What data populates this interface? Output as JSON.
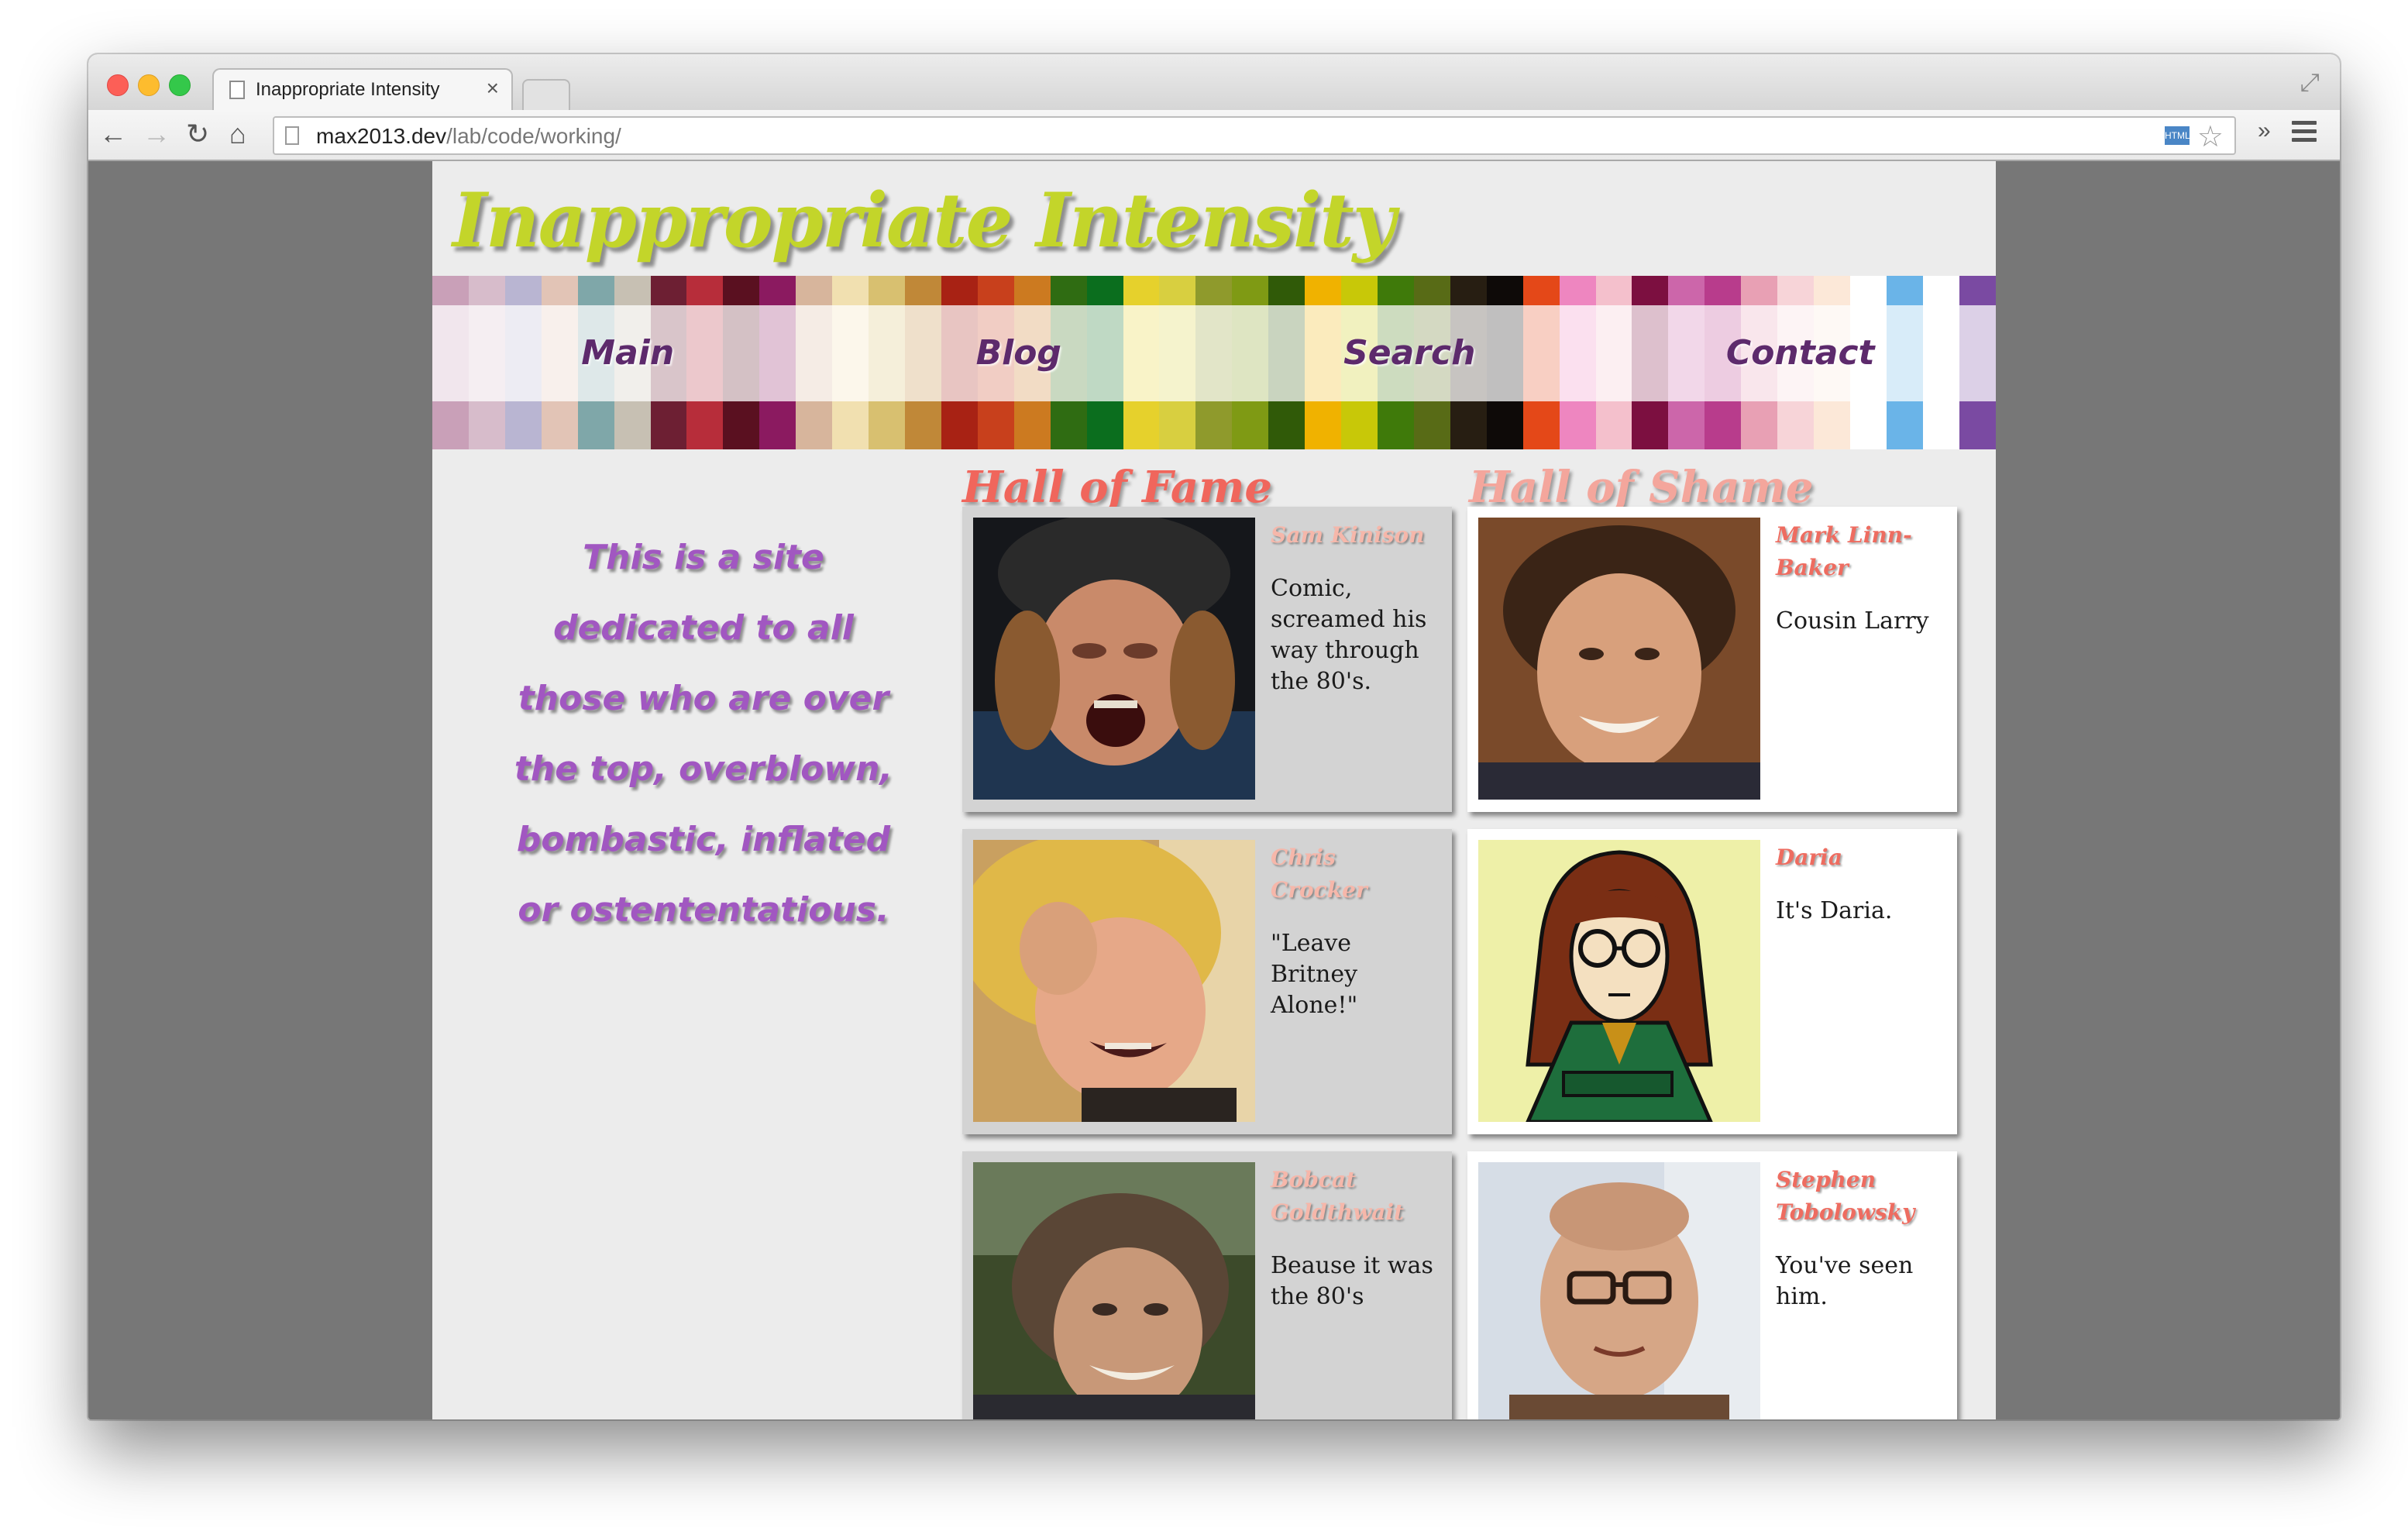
{
  "browser": {
    "tab_title": "Inappropriate Intensity",
    "tab_close": "×",
    "url_host": "max2013.dev",
    "url_path": "/lab/code/working/",
    "icons": {
      "back": "back-arrow-icon",
      "forward": "forward-arrow-icon",
      "reload": "reload-icon",
      "home": "home-icon",
      "star": "star-icon",
      "menu": "hamburger-menu-icon"
    }
  },
  "site": {
    "title": "Inappropriate Intensity",
    "intro": "This is a site dedicated to all those who are over the top, overblown, bombastic, inflated or ostententatious."
  },
  "nav": [
    {
      "label": "Main"
    },
    {
      "label": "Blog"
    },
    {
      "label": "Search"
    },
    {
      "label": "Contact"
    }
  ],
  "hall_of_fame": {
    "heading": "Hall of Fame",
    "cards": [
      {
        "name": "Sam Kinison",
        "description": "Comic, screamed his way through the 80's."
      },
      {
        "name": "Chris Crocker",
        "description": "\"Leave Britney Alone!\""
      },
      {
        "name": "Bobcat Goldthwait",
        "description": "Beause it was the 80's"
      }
    ]
  },
  "hall_of_shame": {
    "heading": "Hall of Shame",
    "cards": [
      {
        "name": "Mark Linn-Baker",
        "description": "Cousin Larry"
      },
      {
        "name": "Daria",
        "description": "It's Daria."
      },
      {
        "name": "Stephen Tobolowsky",
        "description": "You've seen him."
      }
    ]
  },
  "colors": {
    "page_background": "#ececec",
    "window_background": "#777777",
    "title": "#c3d52a",
    "nav_text": "#5d2a6c",
    "intro_text": "#a157c1",
    "fame_heading": "#f0665c",
    "shame_heading": "#f4a69c",
    "fame_card": "#d3d3d3",
    "shame_card": "#ffffff",
    "stripes": [
      "#c9a0b8",
      "#d7bccb",
      "#b9b5d2",
      "#e2c4b6",
      "#7fa7a9",
      "#c7c0b3",
      "#6d1f33",
      "#b72d3a",
      "#5a1020",
      "#8b1a60",
      "#d7b59c",
      "#f1e0b0",
      "#d8c070",
      "#c08838",
      "#a82214",
      "#c8401c",
      "#cc7a20",
      "#2f6c12",
      "#0b6e1e",
      "#e6d12c",
      "#d8cf40",
      "#8f9a2c",
      "#7f9a14",
      "#305a08",
      "#f0b200",
      "#c8c808",
      "#3f7a0a",
      "#586b16",
      "#271e12",
      "#0e0a08",
      "#e44818",
      "#ee86c0",
      "#f4c0cc",
      "#7c0f40",
      "#cc66aa",
      "#b83c8c",
      "#e8a0b4",
      "#f7d4d8",
      "#fce8d8",
      "#ffffff",
      "#6ab4e8",
      "#ffffff",
      "#7a4aa2"
    ]
  }
}
